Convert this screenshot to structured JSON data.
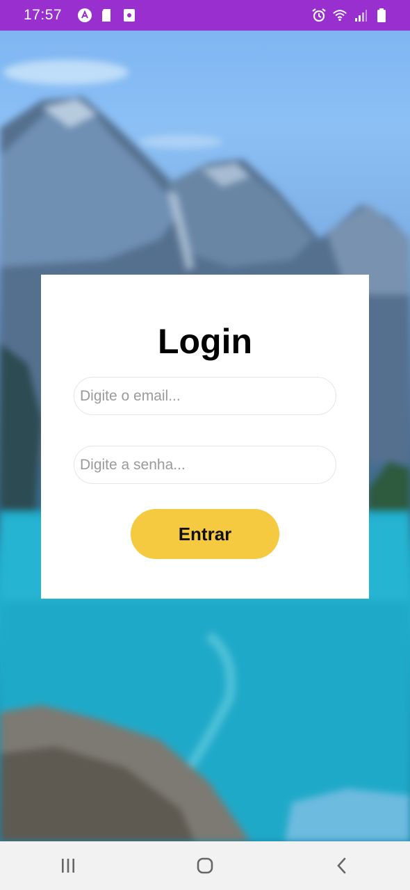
{
  "status_bar": {
    "time": "17:57",
    "left_icons": [
      "a-app-icon",
      "sd-card-icon",
      "screenshot-icon"
    ],
    "right_icons": [
      "alarm-icon",
      "wifi-icon",
      "signal-icon",
      "battery-icon"
    ],
    "color": "#9a2fd0"
  },
  "login": {
    "title": "Login",
    "email_placeholder": "Digite o email...",
    "password_placeholder": "Digite a senha...",
    "submit_label": "Entrar",
    "button_color": "#f5c940"
  },
  "nav": {
    "icons": [
      "recent-apps-icon",
      "home-icon",
      "back-icon"
    ]
  }
}
